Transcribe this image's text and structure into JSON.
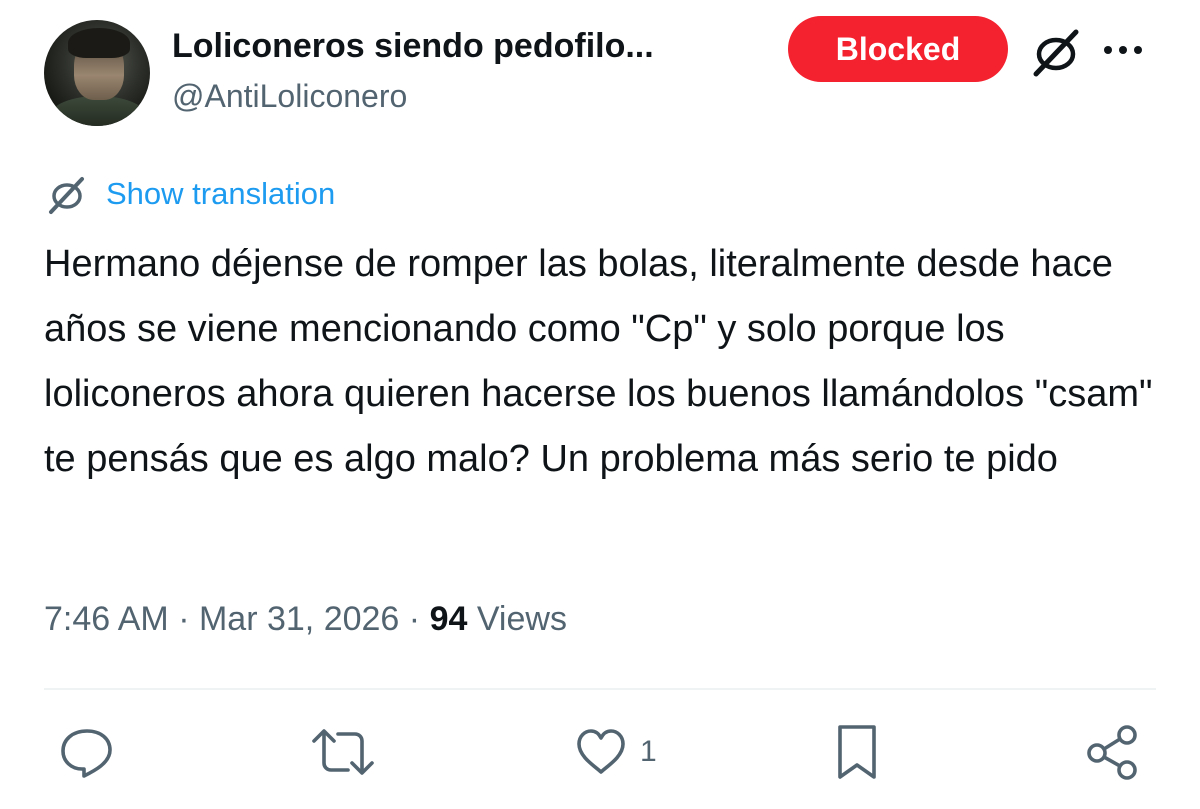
{
  "header": {
    "display_name": "Loliconeros siendo pedofilo...",
    "handle": "@AntiLoliconero",
    "blocked_label": "Blocked"
  },
  "translation": {
    "label": "Show translation"
  },
  "tweet": {
    "text": "Hermano déjense de romper las bolas, literalmente desde hace años se viene mencionando como \"Cp\" y solo porque los loliconeros ahora quieren hacerse los buenos llamándolos \"csam\" te pensás que es algo malo? Un problema más serio te pido"
  },
  "meta": {
    "time": "7:46 AM",
    "separator": "·",
    "date": "Mar 31, 2026",
    "views_count": "94",
    "views_label": "Views"
  },
  "actions": {
    "reply_icon": "reply-icon",
    "retweet_icon": "retweet-icon",
    "like_icon": "heart-icon",
    "like_count": "1",
    "bookmark_icon": "bookmark-icon",
    "share_icon": "share-icon"
  },
  "colors": {
    "accent": "#1d9bf0",
    "blocked": "#f4212e",
    "secondary_text": "#536471",
    "primary_text": "#0f1419",
    "divider": "#eff3f4"
  }
}
